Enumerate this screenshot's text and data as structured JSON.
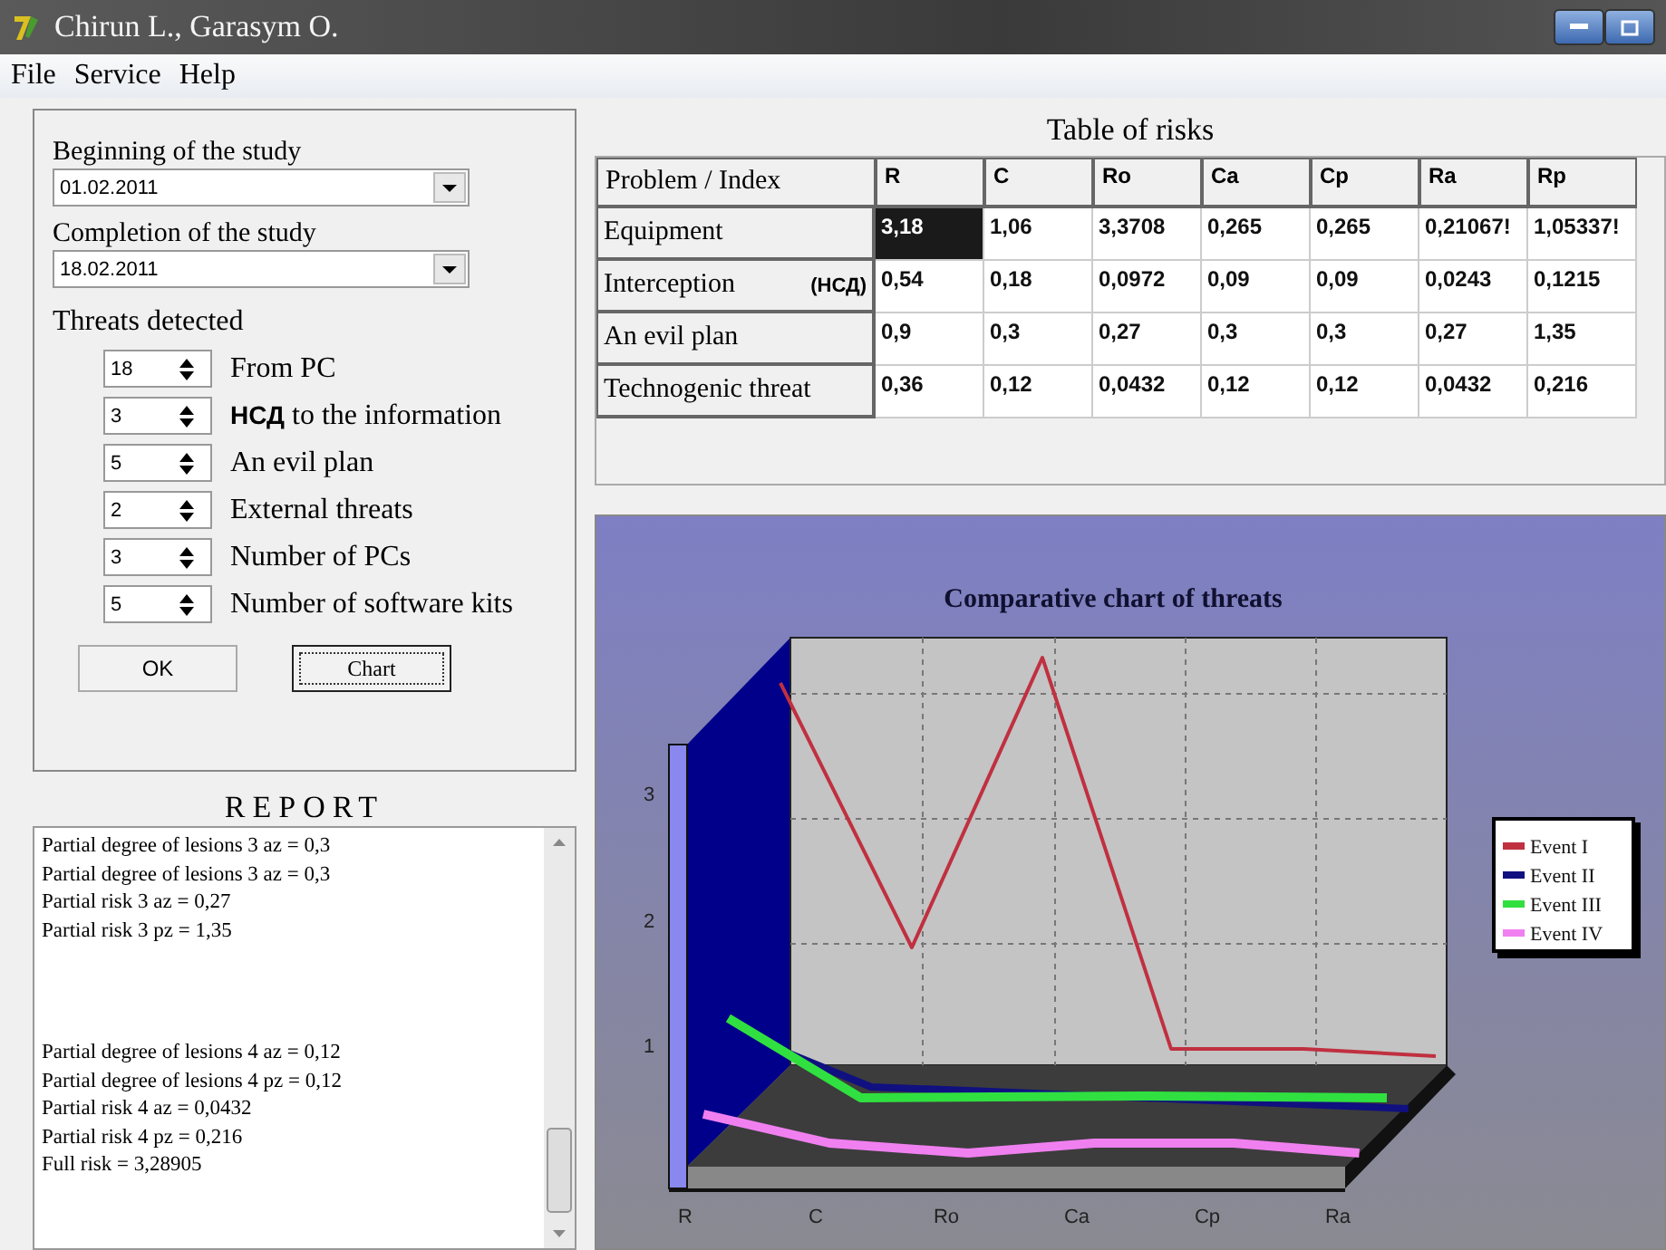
{
  "window": {
    "title": "Chirun L., Garasym O."
  },
  "menu": [
    "File",
    "Service",
    "Help"
  ],
  "study": {
    "begin_label": "Beginning of the study",
    "begin_value": "01.02.2011",
    "end_label": "Completion of the study",
    "end_value": "18.02.2011"
  },
  "threats": {
    "label": "Threats detected",
    "items": [
      {
        "value": "18",
        "label": "From PC"
      },
      {
        "value": "3",
        "label": "to the information",
        "bold_prefix": "НСД"
      },
      {
        "value": "5",
        "label": "An evil plan"
      },
      {
        "value": "2",
        "label": "External threats"
      },
      {
        "value": "3",
        "label": "Number of PCs"
      },
      {
        "value": "5",
        "label": "Number of software kits"
      }
    ]
  },
  "buttons": [
    {
      "label": "OK",
      "focused": false
    },
    {
      "label": "Chart",
      "focused": true
    }
  ],
  "report": {
    "title": "REPORT",
    "blocks": [
      [
        "Partial degree of lesions 3 az = 0,3",
        "Partial degree of lesions 3 az = 0,3",
        "Partial risk 3 az = 0,27",
        "Partial risk 3 pz = 1,35"
      ],
      [
        "Partial degree of lesions 4 az = 0,12",
        "Partial degree of lesions 4 pz = 0,12",
        "Partial risk 4 az = 0,0432",
        "Partial risk 4 pz = 0,216",
        "Full risk = 3,28905"
      ]
    ]
  },
  "table": {
    "title": "Table of risks",
    "corner": "Problem / Index",
    "columns": [
      "R",
      "C",
      "Ro",
      "Ca",
      "Cp",
      "Ra",
      "Rp"
    ],
    "rows": [
      {
        "name": "Equipment",
        "cells": [
          {
            "text": "3,18",
            "selected": true
          },
          {
            "text": "1,06",
            "selected": false
          },
          {
            "text": "3,3708",
            "selected": false
          },
          {
            "text": "0,265",
            "selected": false
          },
          {
            "text": "0,265",
            "selected": false
          },
          {
            "text": "0,21067!",
            "selected": false
          },
          {
            "text": "1,05337!",
            "selected": false
          }
        ]
      },
      {
        "name": "Interception",
        "note": "(НСД)",
        "cells": [
          {
            "text": "0,54",
            "selected": false
          },
          {
            "text": "0,18",
            "selected": false
          },
          {
            "text": "0,0972",
            "selected": false
          },
          {
            "text": "0,09",
            "selected": false
          },
          {
            "text": "0,09",
            "selected": false
          },
          {
            "text": "0,0243",
            "selected": false
          },
          {
            "text": "0,1215",
            "selected": false
          }
        ]
      },
      {
        "name": "An evil plan",
        "cells": [
          {
            "text": "0,9",
            "selected": false
          },
          {
            "text": "0,3",
            "selected": false
          },
          {
            "text": "0,27",
            "selected": false
          },
          {
            "text": "0,3",
            "selected": false
          },
          {
            "text": "0,3",
            "selected": false
          },
          {
            "text": "0,27",
            "selected": false
          },
          {
            "text": "1,35",
            "selected": false
          }
        ]
      },
      {
        "name": "Technogenic threat",
        "cells": [
          {
            "text": "0,36",
            "selected": false
          },
          {
            "text": "0,12",
            "selected": false
          },
          {
            "text": "0,0432",
            "selected": false
          },
          {
            "text": "0,12",
            "selected": false
          },
          {
            "text": "0,12",
            "selected": false
          },
          {
            "text": "0,0432",
            "selected": false
          },
          {
            "text": "0,216",
            "selected": false
          }
        ]
      }
    ]
  },
  "chart": {
    "title": "Comparative chart of threats",
    "y_labels": [
      "3",
      "2",
      "1"
    ],
    "x_labels": [
      "R",
      "C",
      "Ro",
      "Ca",
      "Cp",
      "Ra"
    ],
    "legend": [
      {
        "name": "Event I",
        "color": "#c03040"
      },
      {
        "name": "Event II",
        "color": "#101080"
      },
      {
        "name": "Event III",
        "color": "#30e040"
      },
      {
        "name": "Event IV",
        "color": "#f080f0"
      }
    ]
  }
}
